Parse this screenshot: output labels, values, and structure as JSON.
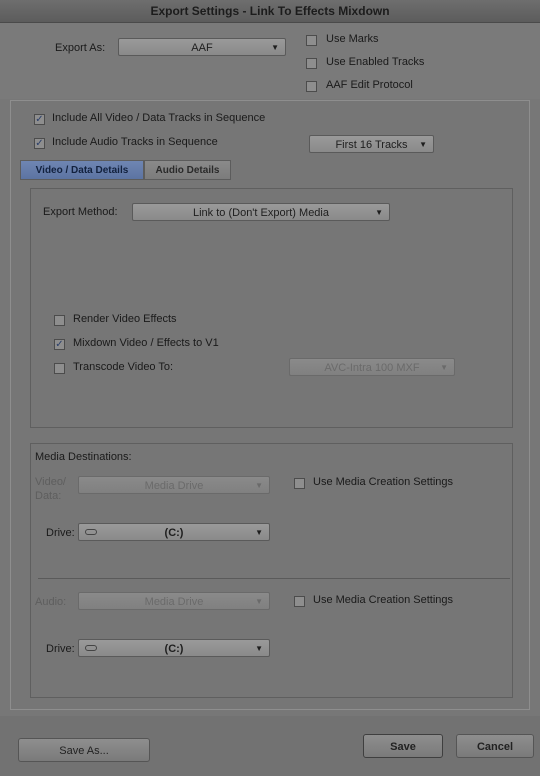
{
  "window": {
    "title": "Export Settings - Link To Effects Mixdown"
  },
  "export_as": {
    "label": "Export As:",
    "value": "AAF",
    "options": {
      "use_marks": {
        "label": "Use Marks",
        "checked": false
      },
      "use_enabled_tracks": {
        "label": "Use Enabled Tracks",
        "checked": false
      },
      "aaf_edit_protocol": {
        "label": "AAF Edit Protocol",
        "checked": false
      }
    }
  },
  "sequence": {
    "include_video": {
      "label": "Include All Video / Data Tracks in Sequence",
      "checked": true
    },
    "include_audio": {
      "label": "Include Audio Tracks in Sequence",
      "checked": true
    },
    "audio_tracks_value": "First 16 Tracks"
  },
  "tabs": [
    {
      "label": "Video / Data Details",
      "active": true
    },
    {
      "label": "Audio Details",
      "active": false
    }
  ],
  "video_details": {
    "export_method_label": "Export Method:",
    "export_method_value": "Link to (Don't Export) Media",
    "render_video_effects": {
      "label": "Render Video Effects",
      "checked": false
    },
    "mixdown_video": {
      "label": "Mixdown Video / Effects to V1",
      "checked": true
    },
    "transcode_video": {
      "label": "Transcode Video To:",
      "checked": false
    },
    "transcode_value": "AVC-Intra 100  MXF"
  },
  "media_destinations": {
    "title": "Media Destinations:",
    "video": {
      "label_line1": "Video/",
      "label_line2": "Data:",
      "value": "Media Drive",
      "use_media_creation": {
        "label": "Use Media Creation Settings",
        "checked": false
      },
      "drive_label": "Drive:",
      "drive_value": "(C:)"
    },
    "audio": {
      "label": "Audio:",
      "value": "Media Drive",
      "use_media_creation": {
        "label": "Use Media Creation Settings",
        "checked": false
      },
      "drive_label": "Drive:",
      "drive_value": "(C:)"
    }
  },
  "buttons": {
    "save_as": "Save As...",
    "save": "Save",
    "cancel": "Cancel"
  },
  "icons": {
    "dropdown_arrow": "chevron-down-icon",
    "checkmark": "checkmark-icon",
    "drive": "drive-icon"
  }
}
